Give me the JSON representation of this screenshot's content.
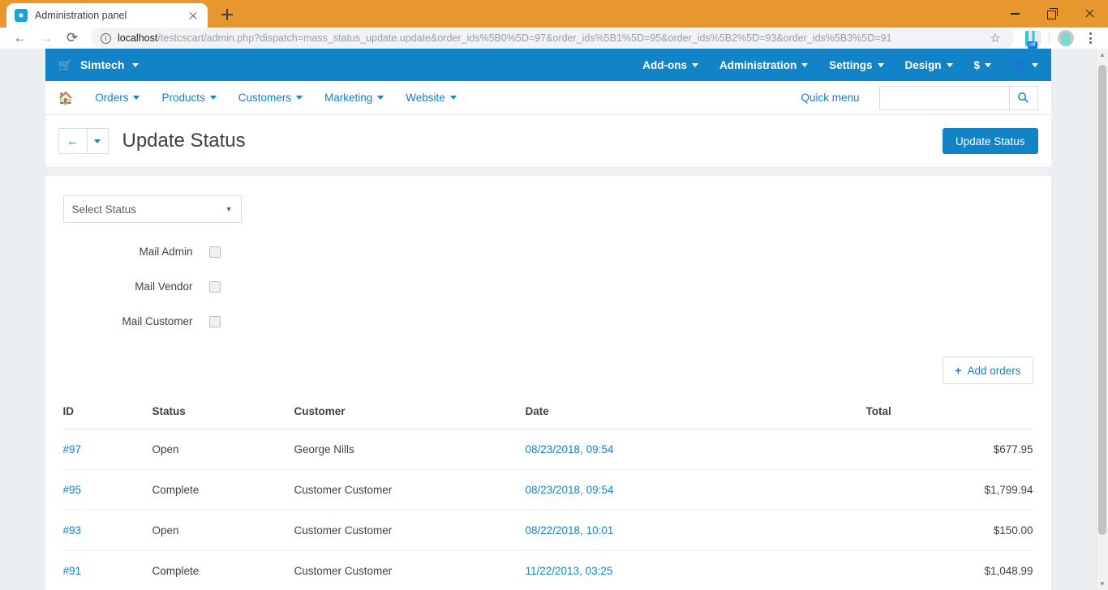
{
  "browser": {
    "tab": {
      "title": "Administration panel",
      "favicon": "gear-icon",
      "close": "×"
    },
    "new_tab_tooltip": "New tab",
    "nav": {
      "back": "←",
      "forward": "→",
      "reload": "⟳"
    },
    "omnibox": {
      "security_label": "i",
      "url_host": "localhost",
      "url_path": "/testcscart/admin.php?dispatch=mass_status_update.update&order_ids%5B0%5D=97&order_ids%5B1%5D=95&order_ids%5B2%5D=93&order_ids%5B3%5D=91",
      "star": "☆"
    },
    "extension_badge": "off",
    "window_controls": {
      "minimize": "−",
      "maximize": "❐",
      "close": "×"
    }
  },
  "topbar": {
    "brand": "Simtech",
    "cart_icon": "🛒",
    "menu": [
      {
        "label": "Add-ons",
        "has_caret": true
      },
      {
        "label": "Administration",
        "has_caret": true
      },
      {
        "label": "Settings",
        "has_caret": true
      },
      {
        "label": "Design",
        "has_caret": true
      },
      {
        "label": "$",
        "has_caret": true
      }
    ],
    "user_menu_icon": "user-icon",
    "accent_color": "#1383c8"
  },
  "subnav": {
    "home_icon": "home-icon",
    "items": [
      {
        "label": "Orders"
      },
      {
        "label": "Products"
      },
      {
        "label": "Customers"
      },
      {
        "label": "Marketing"
      },
      {
        "label": "Website"
      }
    ],
    "quick_menu": "Quick menu",
    "search": {
      "value": "",
      "placeholder": "",
      "icon": "search-icon"
    }
  },
  "page_header": {
    "back_icon": "arrow-left-icon",
    "title": "Update Status",
    "primary_button": "Update Status"
  },
  "form": {
    "status_select": {
      "value": "Select Status",
      "arrow": "▼"
    },
    "checkboxes": [
      {
        "label": "Mail Admin",
        "checked": false
      },
      {
        "label": "Mail Vendor",
        "checked": false
      },
      {
        "label": "Mail Customer",
        "checked": false
      }
    ],
    "add_orders_button": {
      "icon": "plus-icon",
      "label": "Add orders"
    }
  },
  "orders_table": {
    "columns": [
      "ID",
      "Status",
      "Customer",
      "Date",
      "Total"
    ],
    "rows": [
      {
        "id": "#97",
        "status": "Open",
        "customer": "George Nills",
        "date": "08/23/2018, 09:54",
        "total": "$677.95"
      },
      {
        "id": "#95",
        "status": "Complete",
        "customer": "Customer Customer",
        "date": "08/23/2018, 09:54",
        "total": "$1,799.94"
      },
      {
        "id": "#93",
        "status": "Open",
        "customer": "Customer Customer",
        "date": "08/22/2018, 10:01",
        "total": "$150.00"
      },
      {
        "id": "#91",
        "status": "Complete",
        "customer": "Customer Customer",
        "date": "11/22/2013, 03:25",
        "total": "$1,048.99"
      }
    ]
  },
  "scrollbar": {
    "up": "▲",
    "down": "▼"
  }
}
